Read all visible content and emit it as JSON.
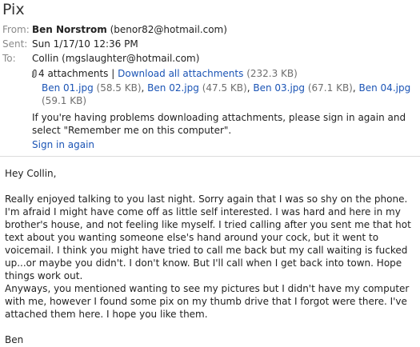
{
  "subject": "Pix",
  "header": {
    "from_label": "From:",
    "from_name": "Ben Norstrom",
    "from_email": "(benor82@hotmail.com)",
    "sent_label": "Sent:",
    "sent_value": "Sun 1/17/10 12:36 PM",
    "to_label": "To:",
    "to_value": "Collin (mgslaughter@hotmail.com)"
  },
  "attachments": {
    "count_label": "4 attachments",
    "separator": "|",
    "download_all": "Download all attachments",
    "total_size": "(232.3 KB)",
    "files": [
      {
        "name": "Ben 01.jpg",
        "size": "(58.5 KB)"
      },
      {
        "name": "Ben 02.jpg",
        "size": "(47.5 KB)"
      },
      {
        "name": "Ben 03.jpg",
        "size": "(67.1 KB)"
      },
      {
        "name": "Ben 04.jpg",
        "size": "(59.1 KB)"
      }
    ]
  },
  "notice": {
    "text": "If you're having problems downloading attachments, please sign in again and select \"Remember me on this computer\".",
    "signin_link": "Sign in again"
  },
  "message": {
    "greeting": "Hey Collin,",
    "paragraph1": "Really enjoyed talking to you last night.  Sorry again that I was so shy on the phone.  I'm afraid I might have come off as little self interested.  I was hard and here in my brother's house, and not feeling like myself.  I tried calling after you sent me that hot text about you wanting someone else's hand around your cock, but it went to voicemail.  I think you might have tried to call me back but my call waiting is fucked up...or maybe you didn't.  I don't know.  But I'll call when I get back into town.  Hope things work out.",
    "paragraph2": "Anyways, you mentioned wanting to see my pictures but I didn't have my computer with me, however I found some pix on my thumb drive that I forgot were there.  I've attached them here.  I hope you like them.",
    "signature": "Ben"
  },
  "icons": {
    "attachment": "paperclip-icon"
  },
  "colors": {
    "link": "#1b54b5",
    "label": "#8a8a8a"
  }
}
